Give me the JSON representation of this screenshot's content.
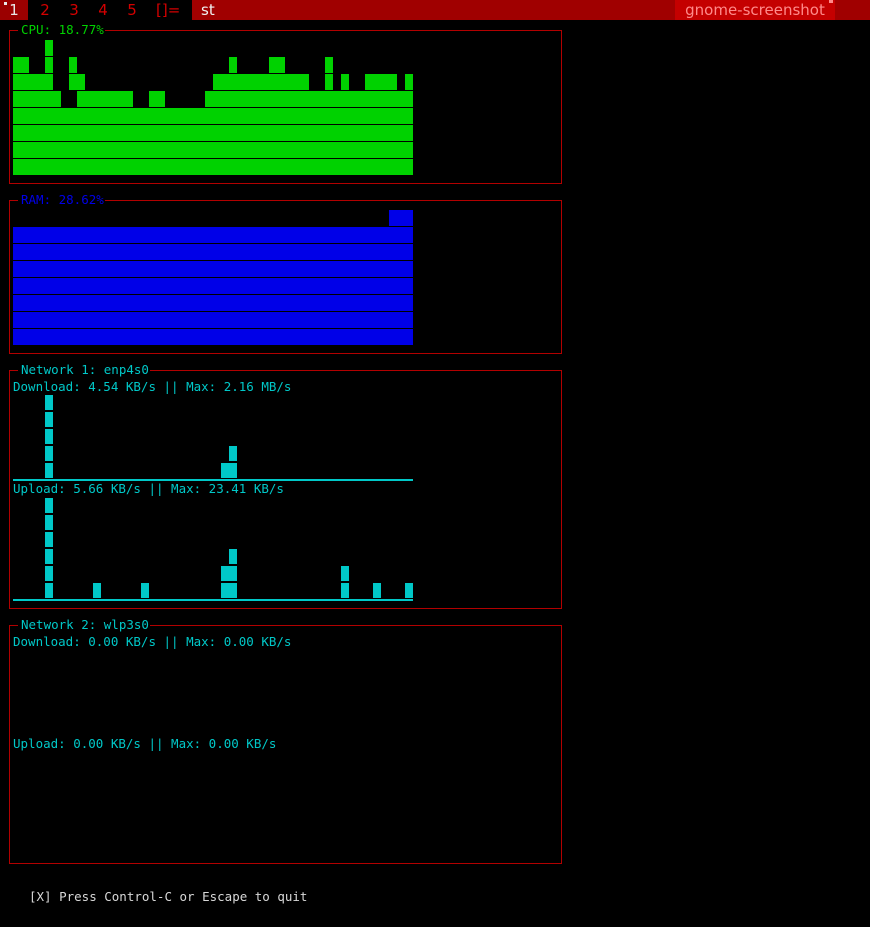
{
  "topbar": {
    "tags": [
      "1",
      "2",
      "3",
      "4",
      "5"
    ],
    "active_tag_index": 0,
    "layout_symbol": "[]=",
    "window_title": "st",
    "status_text": "gnome-screenshot",
    "colors": {
      "bar_bg": "#a00000",
      "tag_text": "#d40000",
      "status_bg": "#c40000"
    }
  },
  "cpu": {
    "label": "CPU: 18.77%",
    "color": "#00d200",
    "max_level": 8,
    "levels": [
      7,
      7,
      6,
      6,
      6,
      6,
      7,
      8,
      5,
      5,
      6,
      7,
      5,
      5,
      5,
      5,
      4,
      4,
      5,
      5,
      5,
      5,
      4,
      4,
      4,
      4,
      4,
      4,
      4,
      4,
      4,
      4,
      4,
      4,
      4,
      4,
      4,
      4,
      4,
      4,
      4,
      4,
      4,
      4,
      4,
      4,
      4,
      4,
      5,
      5,
      5,
      4,
      4,
      4,
      4,
      5,
      5,
      5,
      5,
      5,
      4,
      4,
      4,
      4,
      4,
      4,
      4,
      4,
      4,
      4,
      4,
      4,
      4,
      4,
      4,
      4,
      4,
      4,
      4,
      4,
      4,
      4,
      4,
      4,
      4,
      4,
      4,
      4,
      4,
      4,
      4,
      4,
      4,
      4,
      4,
      4,
      4,
      4,
      4,
      4
    ]
  },
  "ram": {
    "label": "RAM: 28.62%",
    "color": "#0000e8"
  },
  "network1": {
    "label": "Network 1: enp4s0",
    "download_text": "Download: 4.54 KB/s || Max: 2.16 MB/s",
    "upload_text": "Upload: 5.66 KB/s || Max: 23.41 KB/s",
    "color": "#00c8c8"
  },
  "network2": {
    "label": "Network 2: wlp3s0",
    "download_text": "Download: 0.00 KB/s || Max: 0.00 KB/s",
    "upload_text": "Upload: 0.00 KB/s || Max: 0.00 KB/s",
    "color": "#00c8c8"
  },
  "footer": {
    "text": "[X] Press Control-C or Escape to quit"
  }
}
